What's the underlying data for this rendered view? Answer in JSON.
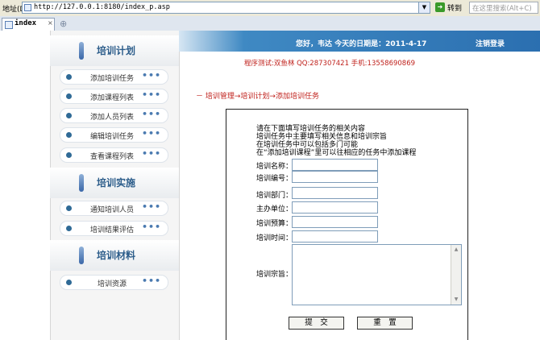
{
  "browser": {
    "address_label": "地址(D)",
    "url": "http://127.0.0.1:8180/index_p.asp",
    "go_label": "转到",
    "search_placeholder": "在这里搜索(Alt+C)",
    "tab_title": "index",
    "tab_close": "×"
  },
  "header": {
    "greeting": "您好，韦达   今天的日期是：2011-4-17",
    "logout": "注销登录",
    "program_info": "程序测试:双鱼林  QQ:287307421  手机:13558690869"
  },
  "sidebar": {
    "sections": [
      {
        "title": "培训计划",
        "items": [
          "添加培训任务",
          "添加课程列表",
          "添加人员列表",
          "编辑培训任务",
          "查看课程列表"
        ]
      },
      {
        "title": "培训实施",
        "items": [
          "通知培训人员",
          "培训结果评估"
        ]
      },
      {
        "title": "培训材料",
        "items": [
          "培训资源"
        ]
      }
    ],
    "more": "•••"
  },
  "breadcrumb": "－ 培训管理→培训计划→添加培训任务",
  "form": {
    "intro": [
      "请在下面填写培训任务的相关内容",
      "培训任务中主要填写相关信息和培训宗旨",
      "在培训任务中可以包括多门可能",
      "在“添加培训课程”里可以往相应的任务中添加课程"
    ],
    "fields": [
      {
        "label": "培训名称：",
        "value": ""
      },
      {
        "label": "培训编号：",
        "value": ""
      },
      {
        "label": "培训部门：",
        "value": ""
      },
      {
        "label": "主办单位：",
        "value": ""
      },
      {
        "label": "培训预算：",
        "value": ""
      },
      {
        "label": "培训时间：",
        "value": ""
      }
    ],
    "textarea_label": "培训宗旨：",
    "submit_label": "提　交",
    "reset_label": "重　置"
  }
}
